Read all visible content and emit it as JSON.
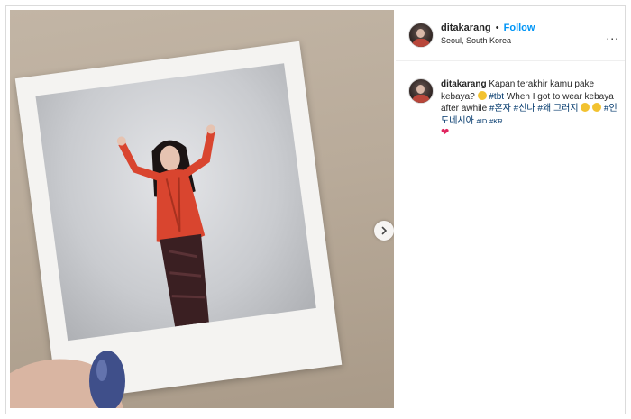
{
  "post": {
    "username": "ditakarang",
    "separator": "•",
    "follow_label": "Follow",
    "location": "Seoul, South Korea",
    "more_label": "..."
  },
  "caption": {
    "username": "ditakarang",
    "text1": "Kapan terakhir kamu pake kebaya?",
    "tag_tbt": "#tbt",
    "text2": "When I got to wear kebaya after awhile",
    "tag1": "#혼자",
    "tag2": "#신나",
    "tag3": "#왜",
    "tag4": "그러지",
    "tag5": "#인도네시아",
    "tag6": "#ID",
    "tag7": "#KR",
    "heart": "❤"
  },
  "icons": {
    "next": "chevron-right-icon",
    "more": "more-horizontal-icon"
  },
  "colors": {
    "follow": "#0095f6",
    "hashtag": "#00376b",
    "kebaya": "#d9452f",
    "heart": "#e0245e"
  }
}
